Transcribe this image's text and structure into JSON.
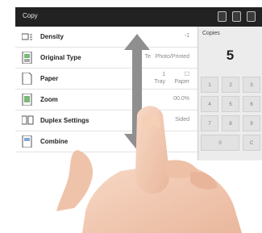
{
  "topbar": {
    "title": "Copy",
    "icons": [
      "bell-icon",
      "copy-status-icon",
      "settings-icon"
    ]
  },
  "rows": [
    {
      "label": "Density",
      "value": "-1",
      "value2": "",
      "icon": "density-icon"
    },
    {
      "label": "Original Type",
      "value": "Te",
      "value2": "Photo/Printed",
      "icon": "original-type-icon"
    },
    {
      "label": "Paper",
      "value": "1",
      "value2": "Tray",
      "value3": "Paper",
      "icon": "paper-icon"
    },
    {
      "label": "Zoom",
      "value": "00.0%",
      "value2": "",
      "icon": "zoom-icon"
    },
    {
      "label": "Duplex Settings",
      "value": "Sided",
      "value2": "",
      "icon": "duplex-icon"
    },
    {
      "label": "Combine",
      "value": "",
      "value2": "",
      "icon": "combine-icon"
    }
  ],
  "copies": {
    "label": "Copies",
    "value": "5"
  },
  "keypad": [
    "1",
    "2",
    "3",
    "4",
    "5",
    "6",
    "7",
    "8",
    "9",
    "0",
    "C"
  ],
  "gesture": {
    "arrow": "up-down-arrow-icon",
    "hand": "hand-icon"
  }
}
